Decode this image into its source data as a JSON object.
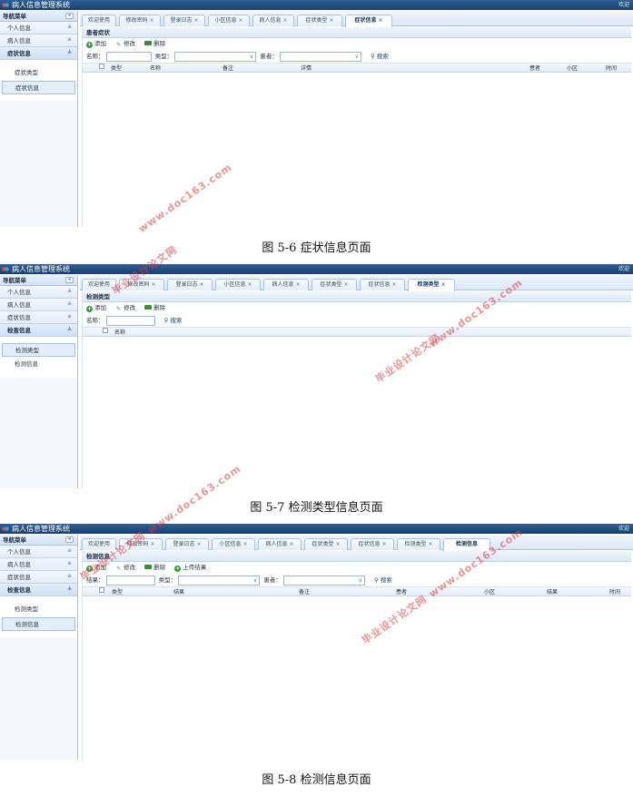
{
  "app_title": "病人信息管理系统",
  "welcome": "欢迎",
  "nav_header": "导航菜单",
  "tabs": [
    "欢迎使用",
    "修改密码",
    "登录日志",
    "小区信息",
    "病人信息",
    "症状类型",
    "症状信息",
    "检测类型",
    "检测信息"
  ],
  "screens": [
    {
      "groups": [
        "个人信息",
        "病人信息",
        "症状信息"
      ],
      "active_group": "症状信息",
      "sub_items": [
        "症状类型",
        "症状信息"
      ],
      "panel_title": "患者症状",
      "toolbar": [
        "添加",
        "修改",
        "删除"
      ],
      "search": {
        "name_label": "名称：",
        "type_label": "类型：",
        "patient_label": "患者：",
        "search_btn": "搜索"
      },
      "columns": [
        "类型",
        "名称",
        "备注",
        "详情",
        "患者",
        "小区",
        "时间"
      ]
    },
    {
      "groups": [
        "个人信息",
        "病人信息",
        "症状信息",
        "检查信息"
      ],
      "active_group": "检查信息",
      "sub_items": [
        "检测类型",
        "检测信息"
      ],
      "panel_title": "检测类型",
      "toolbar": [
        "添加",
        "修改",
        "删除"
      ],
      "search": {
        "name_label": "名称：",
        "search_btn": "搜索"
      },
      "columns": [
        "名称"
      ]
    },
    {
      "groups": [
        "个人信息",
        "病人信息",
        "症状信息",
        "检查信息"
      ],
      "active_group": "检查信息",
      "sub_items": [
        "检测类型",
        "检测信息"
      ],
      "panel_title": "检测信息",
      "toolbar": [
        "添加",
        "修改",
        "删除",
        "上传结果"
      ],
      "search": {
        "name_label": "结果：",
        "type_label": "类型：",
        "patient_label": "患者：",
        "search_btn": "搜索"
      },
      "columns": [
        "类型",
        "结果",
        "备注",
        "患者",
        "小区",
        "结果",
        "时间"
      ]
    }
  ],
  "captions": [
    "图 5-6 症状信息页面",
    "图 5-7 检测类型信息页面",
    "图 5-8 检测信息页面"
  ],
  "watermark_url": "www.doc163.com",
  "watermark_cn": "毕业设计论文网",
  "colors": {
    "titlebar": "#1b3f6e",
    "accent": "#a9c4e2",
    "watermark": "#dc3c3c"
  }
}
